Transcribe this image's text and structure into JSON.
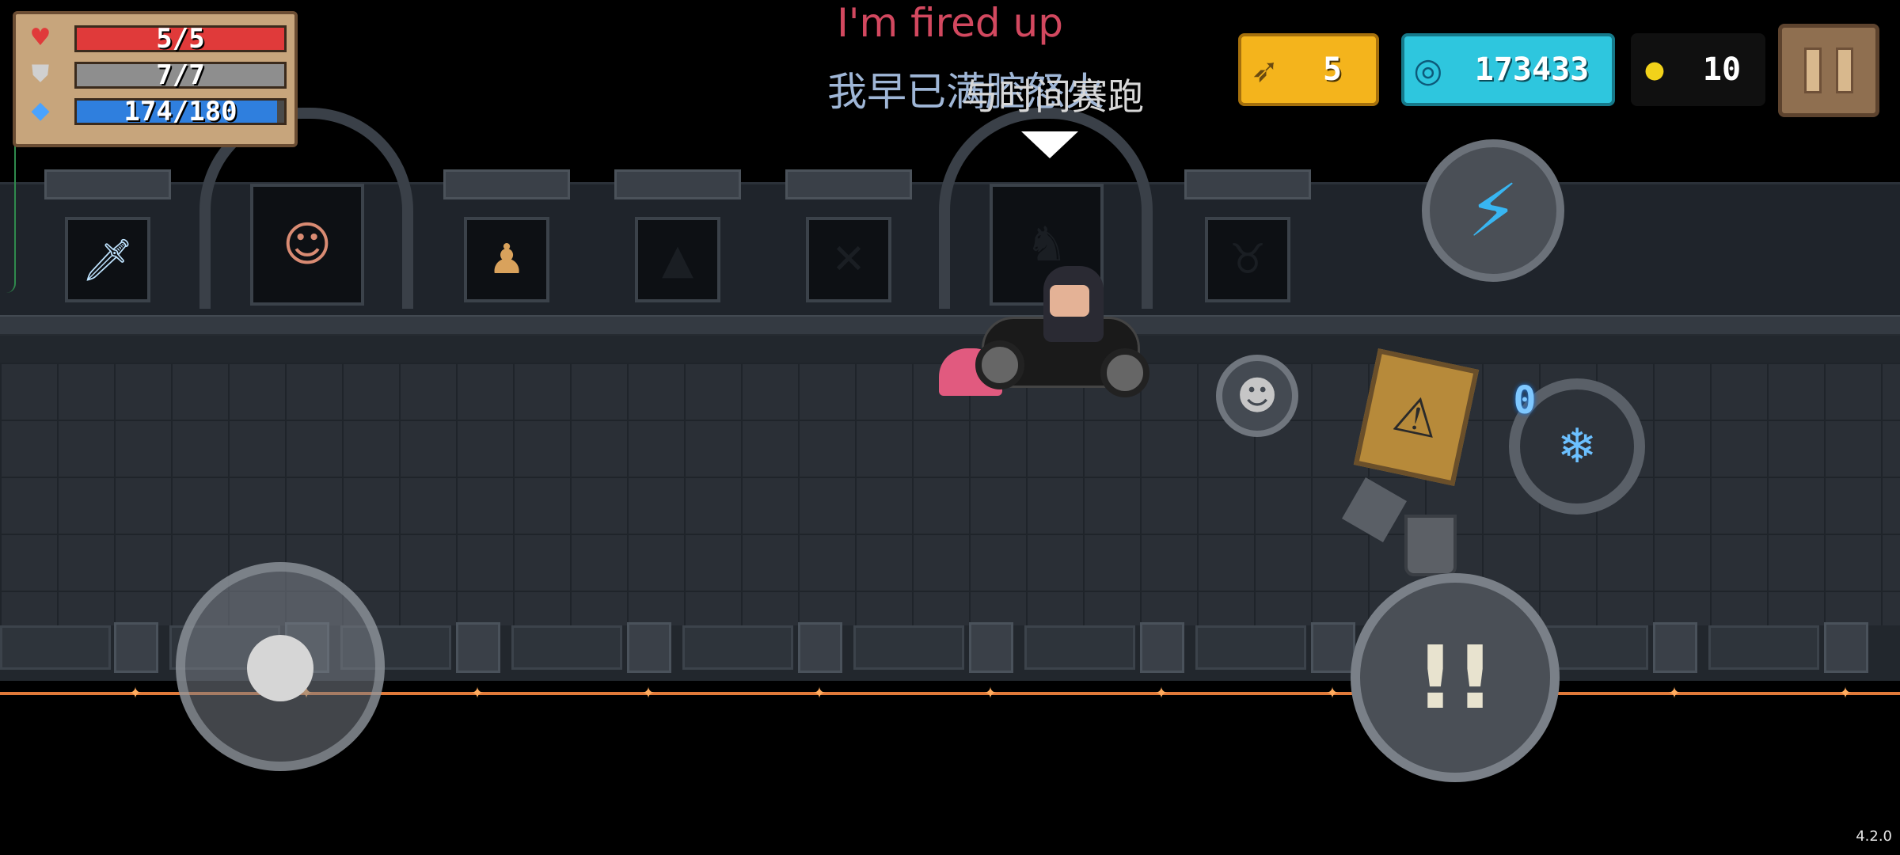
{
  "hud": {
    "health": {
      "text": "5/5",
      "icon": "heart-icon",
      "current": 5,
      "max": 5,
      "color": "#e03a3a"
    },
    "armor": {
      "text": "7/7",
      "icon": "shield-icon",
      "current": 7,
      "max": 7,
      "color": "#8e8e8e"
    },
    "energy": {
      "text": "174/180",
      "icon": "energy-diamond-icon",
      "current": 174,
      "max": 180,
      "color": "#2f7fde"
    }
  },
  "currencies": {
    "fish": {
      "value": "5",
      "icon": "fish-icon"
    },
    "gems": {
      "value": "173433",
      "icon": "gem-icon"
    },
    "coins": {
      "value": "10",
      "icon": "coin-icon"
    }
  },
  "dialogue": {
    "speech": "I'm fired up",
    "subtitle_cn": "我早已满腔怒火",
    "overlay_cn": "与时间赛跑"
  },
  "weapon": {
    "energy_cost": "0",
    "icon": "ice-claw-icon"
  },
  "version": "4.2.0",
  "colors": {
    "health": "#e03a3a",
    "armor": "#8e8e8e",
    "energy": "#2f7fde",
    "fish_pill": "#f4b41c",
    "gem_pill": "#2ec6de",
    "speech": "#d2485f"
  }
}
